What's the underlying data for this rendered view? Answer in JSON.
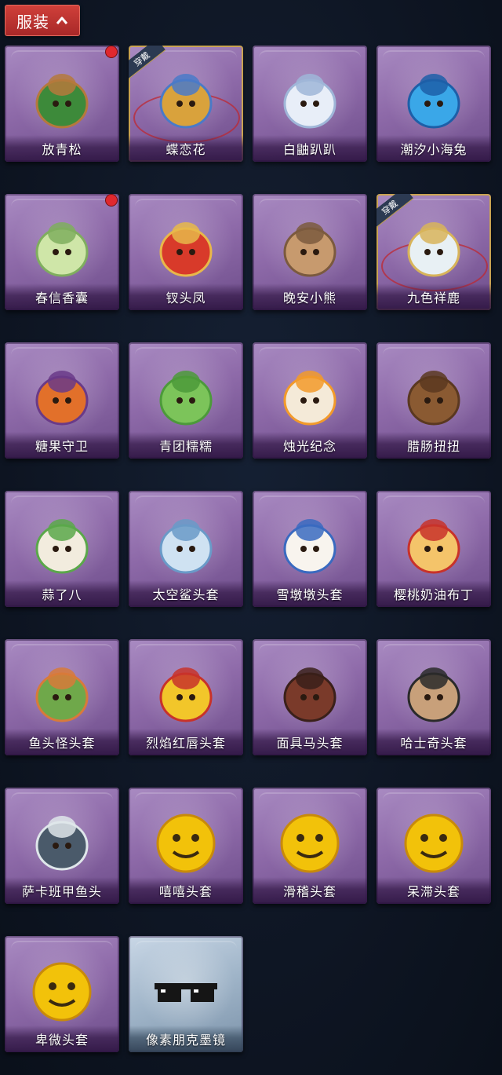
{
  "header": {
    "label": "服装",
    "icon": "chevron-up-icon"
  },
  "items": [
    {
      "name": "放青松",
      "icon": "pine-bonsai-icon",
      "badge": true,
      "equipped": false,
      "rare": false
    },
    {
      "name": "蝶恋花",
      "icon": "butterfly-bell-ornament-icon",
      "badge": false,
      "equipped": true,
      "rare": false
    },
    {
      "name": "白鼬趴趴",
      "icon": "white-ferret-icon",
      "badge": false,
      "equipped": false,
      "rare": false
    },
    {
      "name": "潮汐小海兔",
      "icon": "blue-sea-bunny-icon",
      "badge": false,
      "equipped": false,
      "rare": false
    },
    {
      "name": "春信香囊",
      "icon": "green-sachet-icon",
      "badge": true,
      "equipped": false,
      "rare": false
    },
    {
      "name": "钗头凤",
      "icon": "phoenix-crown-doll-icon",
      "badge": false,
      "equipped": false,
      "rare": false
    },
    {
      "name": "晚安小熊",
      "icon": "teddy-bear-charm-icon",
      "badge": false,
      "equipped": false,
      "rare": false
    },
    {
      "name": "九色祥鹿",
      "icon": "auspicious-deer-icon",
      "badge": false,
      "equipped": true,
      "rare": false
    },
    {
      "name": "糖果守卫",
      "icon": "pumpkin-scarecrow-icon",
      "badge": false,
      "equipped": false,
      "rare": false
    },
    {
      "name": "青团糯糯",
      "icon": "green-dumpling-icon",
      "badge": false,
      "equipped": false,
      "rare": false
    },
    {
      "name": "烛光纪念",
      "icon": "candle-icon",
      "badge": false,
      "equipped": false,
      "rare": false
    },
    {
      "name": "腊肠扭扭",
      "icon": "dachshund-head-icon",
      "badge": false,
      "equipped": false,
      "rare": false
    },
    {
      "name": "蒜了八",
      "icon": "garlic-head-icon",
      "badge": false,
      "equipped": false,
      "rare": false
    },
    {
      "name": "太空鲨头套",
      "icon": "space-shark-mask-icon",
      "badge": false,
      "equipped": false,
      "rare": false
    },
    {
      "name": "雪墩墩头套",
      "icon": "snowman-reindeer-mask-icon",
      "badge": false,
      "equipped": false,
      "rare": false
    },
    {
      "name": "樱桃奶油布丁",
      "icon": "cherry-pudding-icon",
      "badge": false,
      "equipped": false,
      "rare": false
    },
    {
      "name": "鱼头怪头套",
      "icon": "fish-head-mask-icon",
      "badge": false,
      "equipped": false,
      "rare": false
    },
    {
      "name": "烈焰红唇头套",
      "icon": "yellow-lips-sunglasses-mask-icon",
      "badge": false,
      "equipped": false,
      "rare": false
    },
    {
      "name": "面具马头套",
      "icon": "horse-mask-icon",
      "badge": false,
      "equipped": false,
      "rare": false
    },
    {
      "name": "哈士奇头套",
      "icon": "husky-sunglasses-mask-icon",
      "badge": false,
      "equipped": false,
      "rare": false
    },
    {
      "name": "萨卡班甲鱼头",
      "icon": "sacabambaspis-head-icon",
      "badge": false,
      "equipped": false,
      "rare": false
    },
    {
      "name": "嘻嘻头套",
      "icon": "grinning-emoji-mask-icon",
      "badge": false,
      "equipped": false,
      "rare": false
    },
    {
      "name": "滑稽头套",
      "icon": "funny-emoji-mask-icon",
      "badge": false,
      "equipped": false,
      "rare": false
    },
    {
      "name": "呆滞头套",
      "icon": "dazed-emoji-mask-icon",
      "badge": false,
      "equipped": false,
      "rare": false
    },
    {
      "name": "卑微头套",
      "icon": "humble-emoji-mask-icon",
      "badge": false,
      "equipped": false,
      "rare": false
    },
    {
      "name": "像素朋克墨镜",
      "icon": "pixel-sunglasses-icon",
      "badge": false,
      "equipped": false,
      "rare": true
    }
  ],
  "equipped_badge_text": "穿戴",
  "colors": {
    "header_red": "#c0342f",
    "card_purple": "#8e6aa9",
    "card_rare": "#9fb4c8",
    "badge_dot": "#e0282e",
    "equipped_border": "#c9a352"
  }
}
